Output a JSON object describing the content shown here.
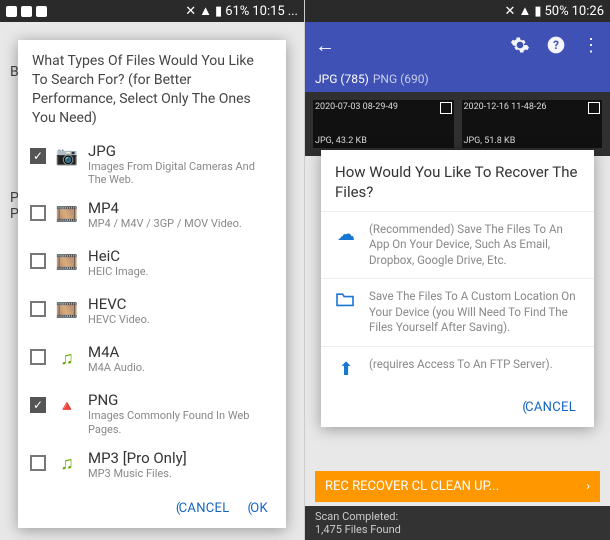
{
  "left": {
    "status": {
      "battery": "61%",
      "time": "10:15",
      "dots": "..."
    },
    "bg_letter1": "B",
    "bg_letter2": "P",
    "bg_letter3": "P",
    "dialog": {
      "title": "What Types Of Files Would You Like To Search For? (for Better Performance, Select Only The Ones You Need)",
      "items": [
        {
          "name": "JPG",
          "desc": "Images From Digital Cameras And The Web.",
          "checked": true,
          "icon": "camera-icon"
        },
        {
          "name": "MP4",
          "desc": "MP4 / M4V / 3GP / MOV Video.",
          "checked": false,
          "icon": "reel-icon"
        },
        {
          "name": "HeiC",
          "desc": "HEIC Image.",
          "checked": false,
          "icon": "reel-icon"
        },
        {
          "name": "HEVC",
          "desc": "HEVC Video.",
          "checked": false,
          "icon": "reel-icon"
        },
        {
          "name": "M4A",
          "desc": "M4A Audio.",
          "checked": false,
          "icon": "music-icon"
        },
        {
          "name": "PNG",
          "desc": "Images Commonly Found In Web Pages.",
          "checked": true,
          "icon": "logo-icon"
        },
        {
          "name": "MP3   [Pro Only]",
          "desc": "MP3 Music Files.",
          "checked": false,
          "icon": "music-icon"
        }
      ],
      "cancel": "CANCEL",
      "ok": "OK"
    }
  },
  "right": {
    "status": {
      "battery": "50%",
      "time": "10:26"
    },
    "tabs": {
      "jpg": "JPG (785)",
      "png": "PNG (690)"
    },
    "thumbs": [
      {
        "ts": "2020-07-03 08-29-49",
        "meta": "JPG, 43.2 KB"
      },
      {
        "ts": "2020-12-16 11-48-26",
        "meta": "JPG, 51.8 KB"
      }
    ],
    "dialog": {
      "title": "How Would You Like To Recover The Files?",
      "options": [
        {
          "icon": "cloud-icon",
          "text": "(Recommended) Save The Files To An App On Your Device, Such As Email, Dropbox, Google Drive, Etc."
        },
        {
          "icon": "folder-icon",
          "text": "Save The Files To A Custom Location On Your Device (you Will Need To Find The Files Yourself After Saving)."
        },
        {
          "icon": "upload-icon",
          "text": "(requires Access To An FTP Server)."
        }
      ],
      "cancel": "CANCEL"
    },
    "orange": "REC RECOVER  CL CLEAN UP...",
    "scan": {
      "l1": "Scan Completed:",
      "l2": "1,475 Files Found"
    }
  }
}
